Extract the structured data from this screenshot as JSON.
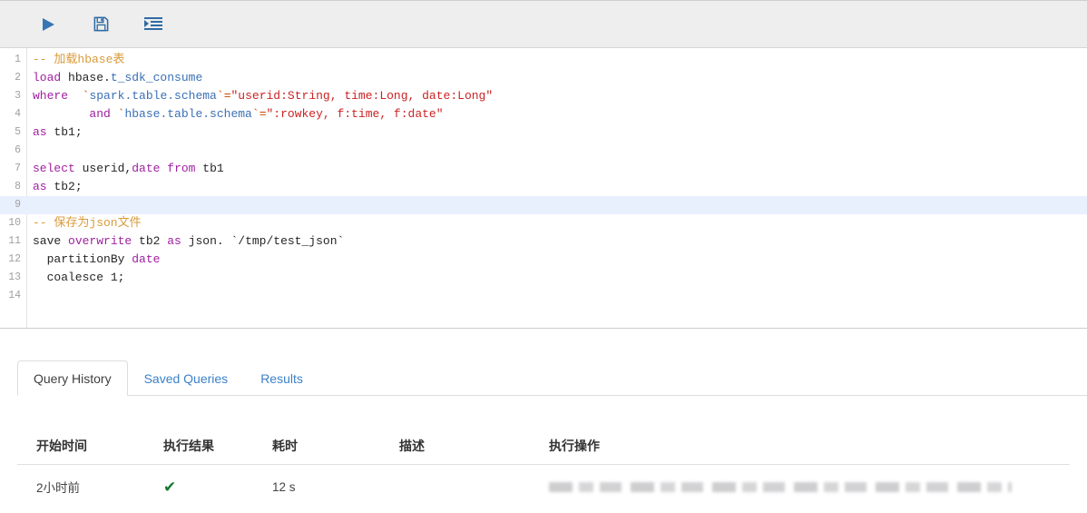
{
  "toolbar": {
    "buttons": [
      {
        "name": "run-query-button",
        "icon": "play-icon",
        "title": "Run"
      },
      {
        "name": "save-query-button",
        "icon": "save-icon",
        "title": "Save"
      },
      {
        "name": "format-query-button",
        "icon": "format-indent-icon",
        "title": "Format"
      }
    ]
  },
  "editor": {
    "active_line": 9,
    "total_lines": 14,
    "lines": [
      {
        "num": "1",
        "tokens": [
          {
            "t": "-- 加载hbase表",
            "c": "cmt"
          }
        ]
      },
      {
        "num": "2",
        "tokens": [
          {
            "t": "load",
            "c": "kw"
          },
          {
            "t": " hbase.",
            "c": "plain"
          },
          {
            "t": "t_sdk_consume",
            "c": "ident"
          }
        ]
      },
      {
        "num": "3",
        "tokens": [
          {
            "t": "where",
            "c": "kw"
          },
          {
            "t": "  ",
            "c": "plain"
          },
          {
            "t": "`",
            "c": "punct"
          },
          {
            "t": "spark.table.schema",
            "c": "ident"
          },
          {
            "t": "`",
            "c": "punct"
          },
          {
            "t": "=",
            "c": "punct"
          },
          {
            "t": "\"userid:String, time:Long, date:Long\"",
            "c": "str"
          }
        ]
      },
      {
        "num": "4",
        "tokens": [
          {
            "t": "        and ",
            "c": "kw"
          },
          {
            "t": "`",
            "c": "punct"
          },
          {
            "t": "hbase.table.schema",
            "c": "ident"
          },
          {
            "t": "`",
            "c": "punct"
          },
          {
            "t": "=",
            "c": "punct"
          },
          {
            "t": "\":rowkey, f:time, f:date\"",
            "c": "str"
          }
        ]
      },
      {
        "num": "5",
        "tokens": [
          {
            "t": "as",
            "c": "kw"
          },
          {
            "t": " tb1;",
            "c": "plain"
          }
        ]
      },
      {
        "num": "6",
        "tokens": []
      },
      {
        "num": "7",
        "tokens": [
          {
            "t": "select",
            "c": "kw"
          },
          {
            "t": " userid,",
            "c": "plain"
          },
          {
            "t": "date",
            "c": "kw"
          },
          {
            "t": " ",
            "c": "plain"
          },
          {
            "t": "from",
            "c": "kw"
          },
          {
            "t": " tb1",
            "c": "plain"
          }
        ]
      },
      {
        "num": "8",
        "tokens": [
          {
            "t": "as",
            "c": "kw"
          },
          {
            "t": " tb2;",
            "c": "plain"
          }
        ]
      },
      {
        "num": "9",
        "tokens": []
      },
      {
        "num": "10",
        "tokens": [
          {
            "t": "-- 保存为json文件",
            "c": "cmt"
          }
        ]
      },
      {
        "num": "11",
        "tokens": [
          {
            "t": "save ",
            "c": "plain"
          },
          {
            "t": "overwrite",
            "c": "kw"
          },
          {
            "t": " tb2 ",
            "c": "plain"
          },
          {
            "t": "as",
            "c": "kw"
          },
          {
            "t": " json.",
            "c": "plain"
          },
          {
            "t": " `/tmp/test_json`",
            "c": "plain"
          }
        ]
      },
      {
        "num": "12",
        "tokens": [
          {
            "t": "  partitionBy ",
            "c": "plain"
          },
          {
            "t": "date",
            "c": "kw"
          }
        ]
      },
      {
        "num": "13",
        "tokens": [
          {
            "t": "  coalesce 1;",
            "c": "plain"
          }
        ]
      },
      {
        "num": "14",
        "tokens": []
      }
    ]
  },
  "panel": {
    "tabs": [
      {
        "label": "Query History",
        "active": true
      },
      {
        "label": "Saved Queries",
        "active": false
      },
      {
        "label": "Results",
        "active": false
      }
    ],
    "table": {
      "headers": [
        "开始时间",
        "执行结果",
        "耗时",
        "描述",
        "执行操作"
      ],
      "rows": [
        {
          "start_time": "2小时前",
          "result": "✔",
          "duration": "12 s",
          "description": "",
          "operation": ""
        }
      ]
    }
  },
  "colors": {
    "accent": "#3c81c9",
    "toolbar_bg": "#eeeeee",
    "active_line": "#e8f0fe",
    "success": "#157a32",
    "comment": "#d89b3a",
    "keyword": "#a020a0",
    "identifier": "#3a6fb5",
    "string": "#cc2222"
  }
}
